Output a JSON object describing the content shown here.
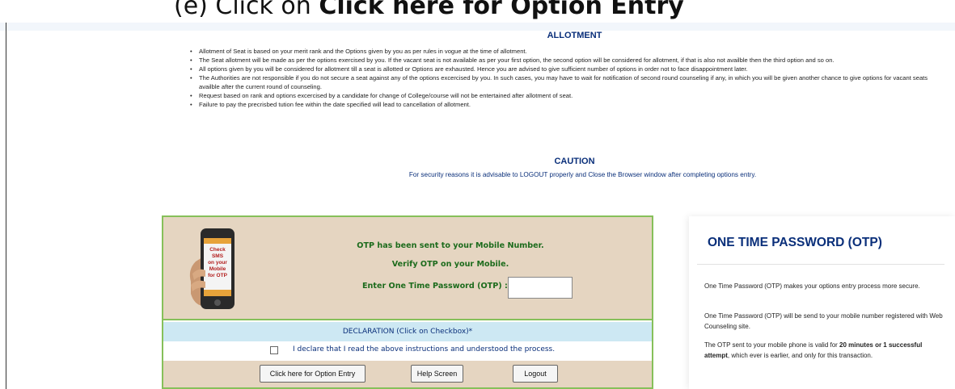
{
  "heading": {
    "prefix": "(e) Click on ",
    "bold": "Click here for Option Entry"
  },
  "allotment": {
    "title": "ALLOTMENT",
    "rules": [
      "Allotment of Seat is based on your merit rank and the Options given by you as per rules in vogue at the time of allotment.",
      "The Seat allotment will be made as per the options exercised by you. If the vacant seat is not available as per your first option, the second option will be considered for allotment, if that is also not availble then the third option and so on.",
      "All options given by you will be considered for allotment till a seat is allotted or Options are exhausted. Hence you are advised to give sufficient number of options in order not to face disappointment later.",
      "The Authorities are not responsible if you do not secure a seat against any of the options excercised by you. In such cases, you may have to wait for notification of second round counseling if any, in which you will be given another chance to give options for vacant seats availble after the current round of counseling.",
      "Request based on rank and options excercised by a candidate for change of College/course will not be entertained after allotment of seat.",
      "Failure to pay the precrisbed tution fee within the date specified will lead to cancellation of allotment."
    ]
  },
  "caution": {
    "title": "CAUTION",
    "text": "For security reasons it is advisable to LOGOUT properly and Close the Browser window after completing options entry."
  },
  "otp": {
    "phone_lines": [
      "Check",
      "SMS",
      "on your",
      "Mobile",
      "for OTP"
    ],
    "line1": "OTP has been sent to your Mobile Number.",
    "line2": "Verify OTP on your Mobile.",
    "enter_label": "Enter One Time Password (OTP) :",
    "input_value": ""
  },
  "declaration": {
    "heading": "DECLARATION (Click on Checkbox)*",
    "text": "I declare that I read the above instructions and understood the process.",
    "checked": false
  },
  "buttons": {
    "option_entry": "Click here for Option Entry",
    "help": "Help Screen",
    "logout": "Logout"
  },
  "side_panel": {
    "title": "ONE TIME PASSWORD (OTP)",
    "p1": "One Time Password (OTP) makes your options entry process more secure.",
    "p2": "One Time Password (OTP) will be send to your mobile number registered with Web Counseling site.",
    "p3_pre": "The OTP sent to your mobile phone is valid for ",
    "p3_bold": "20 minutes or 1 successful attempt",
    "p3_post": ", which ever is earlier, and only for this transaction."
  },
  "colors": {
    "accent": "#0a2f7a",
    "green_text": "#1c6b1c",
    "panel_beige": "#e5d5c1",
    "border_green": "#86c05a",
    "decl_blue": "#cde8f3"
  }
}
